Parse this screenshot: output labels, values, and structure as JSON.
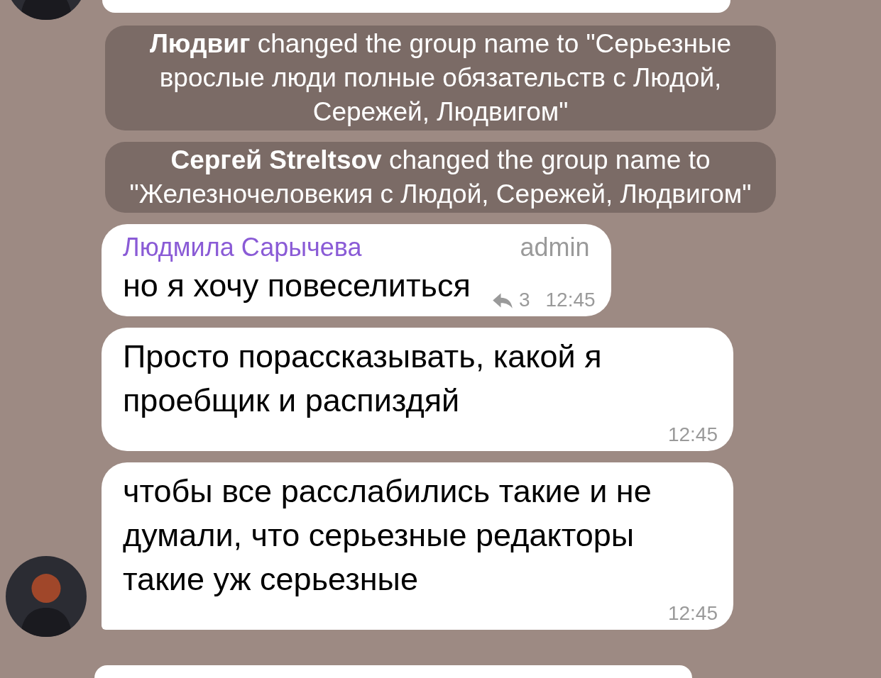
{
  "items": [
    {
      "kind": "service",
      "text": "**Людвиг** changed the group name to \"Серьезные вроcлые люди полные обязательств с Людой, Сережей, Людвигом\""
    },
    {
      "kind": "service",
      "text": "**Сергей Streltsov** changed the group name to \"Железночеловекия с Людой, Сережей, Людвигом\""
    },
    {
      "kind": "message",
      "sender": "Людмила Сарычева",
      "role": "admin",
      "text": "но я хочу повеселиться",
      "replies": "3",
      "time": "12:45",
      "show_avatar": false
    },
    {
      "kind": "message",
      "text": "Просто порассказывать, какой я проебщик и распиздяй",
      "time": "12:45",
      "show_avatar": false
    },
    {
      "kind": "message",
      "text": "чтобы все расслабились такие и не думали, что серьезные редакторы такие уж серьезные",
      "time": "12:45",
      "show_avatar": true
    }
  ]
}
